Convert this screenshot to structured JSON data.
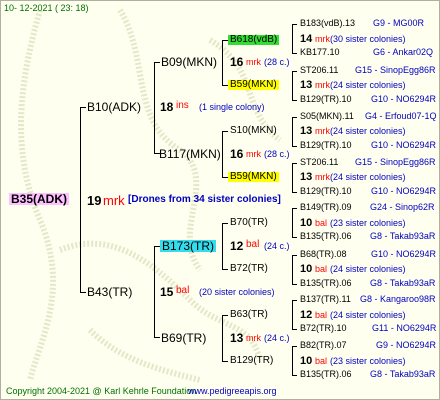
{
  "header": {
    "date": "10-  12-2021  (  23:  18)"
  },
  "root": {
    "name": "B35(ADK)",
    "num": "19",
    "mark": "mrk",
    "note": "Drones from 34 sister colonies"
  },
  "gen1": [
    {
      "name": "B10(ADK)",
      "num": "18",
      "mark": "ins",
      "note": "(1 single colony)"
    },
    {
      "name": "B43(TR)",
      "num": "15",
      "mark": "bal",
      "note": "(20 sister colonies)"
    }
  ],
  "gen2": [
    {
      "name": "B09(MKN)",
      "num": "16",
      "mark": "mrk",
      "note": "(28 c.)"
    },
    {
      "name": "B117(MKN)",
      "num": "16",
      "mark": "mrk",
      "note": "(28 c.)"
    },
    {
      "name": "B173(TR)",
      "num": "12",
      "mark": "bal",
      "note": "(24 c.)"
    },
    {
      "name": "B69(TR)",
      "num": "13",
      "mark": "mrk",
      "note": "(24 c.)"
    }
  ],
  "gen3": [
    {
      "name": "B618(vdB)",
      "num": "14",
      "mark": "mrk",
      "note": "(30 sister colonies)"
    },
    {
      "name": "B59(MKN)",
      "num": "13",
      "mark": "mrk",
      "note": "(24 sister colonies)"
    },
    {
      "name": "S10(MKN)",
      "num": "13",
      "mark": "mrk",
      "note": "(24 sister colonies)"
    },
    {
      "name": "B59(MKN)",
      "num": "13",
      "mark": "mrk",
      "note": "(24 sister colonies)"
    },
    {
      "name": "B70(TR)",
      "num": "10",
      "mark": "bal",
      "note": "(23 sister colonies)"
    },
    {
      "name": "B72(TR)",
      "num": "10",
      "mark": "bal",
      "note": "(24 sister colonies)"
    },
    {
      "name": "B63(TR)",
      "num": "12",
      "mark": "bal",
      "note": "(24 sister colonies)"
    },
    {
      "name": "B129(TR)",
      "num": "10",
      "mark": "bal",
      "note": "(23 sister colonies)"
    }
  ],
  "gen4": [
    {
      "name": "B183(vdB).13",
      "group": "G9 - MG00R"
    },
    {
      "name": "KB177.10",
      "group": "G6 - Ankar02Q"
    },
    {
      "name": "ST206.11",
      "group": "G15 - SinopEgg86R"
    },
    {
      "name": "B129(TR).10",
      "group": "G10 - NO6294R"
    },
    {
      "name": "S05(MKN).11",
      "group": "G4 - Erfoud07-1Q"
    },
    {
      "name": "B129(TR).10",
      "group": "G10 - NO6294R"
    },
    {
      "name": "ST206.11",
      "group": "G15 - SinopEgg86R"
    },
    {
      "name": "B129(TR).10",
      "group": "G10 - NO6294R"
    },
    {
      "name": "B149(TR).09",
      "group": "G24 - Sinop62R"
    },
    {
      "name": "B135(TR).06",
      "group": "G8 - Takab93aR"
    },
    {
      "name": "B68(TR).08",
      "group": "G10 - NO6294R"
    },
    {
      "name": "B135(TR).06",
      "group": "G8 - Takab93aR"
    },
    {
      "name": "B137(TR).11",
      "group": "G8 - Kangaroo98R"
    },
    {
      "name": "B72(TR).10",
      "group": "G11 - NO6294R"
    },
    {
      "name": "B82(TR).07",
      "group": "G9 - NO6294R"
    },
    {
      "name": "B135(TR).06",
      "group": "G8 - Takab93aR"
    }
  ],
  "footer": {
    "copyright": "Copyright 2004-2021 @ Karl Kehrle Foundation",
    "url": "www.pedigreeapis.org"
  }
}
